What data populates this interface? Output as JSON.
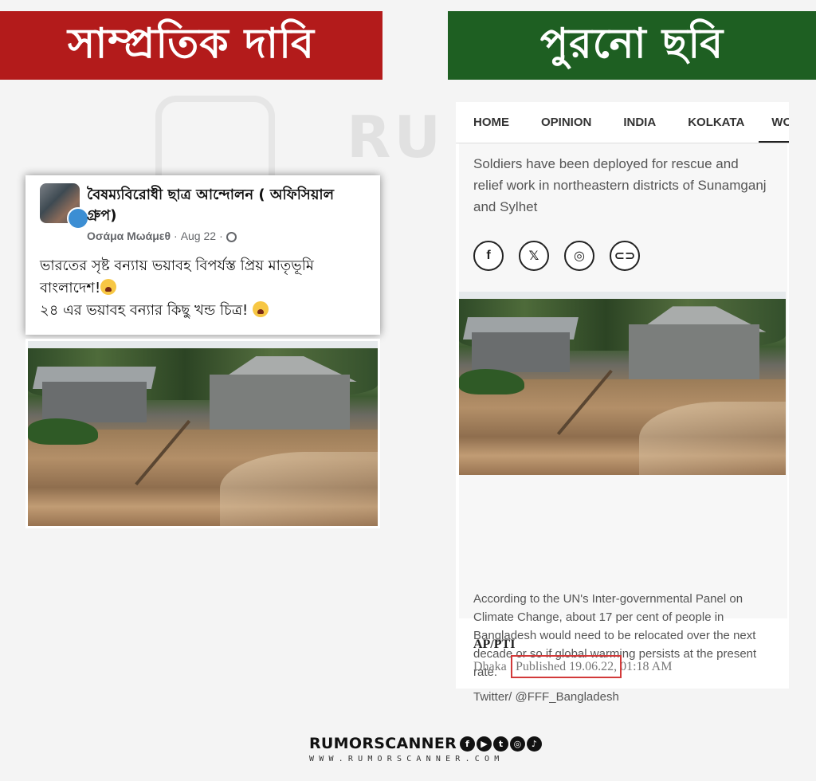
{
  "banners": {
    "left": "সাম্প্রতিক দাবি",
    "right": "পুরনো ছবি"
  },
  "facebook_post": {
    "group_name": "বৈষম্যবিরোধী ছাত্র আন্দোলন ( অফিসিয়াল গ্রুপ)",
    "author": "Οσάμα Μωάμεθ",
    "date": "Aug 22",
    "separator": "·",
    "line1": "ভারতের সৃষ্ট বন্যায় ভয়াবহ বিপর্যস্ত প্রিয় মাতৃভূমি বাংলাদেশ!",
    "line2": "২৪ এর ভয়াবহ বন্যার কিছু খন্ড চিত্র! "
  },
  "news_article": {
    "nav": [
      "HOME",
      "OPINION",
      "INDIA",
      "KOLKATA",
      "WO"
    ],
    "caption_top": "Soldiers have been deployed for rescue and relief work in northeastern districts of Sunamganj and Sylhet",
    "share_icons": [
      "facebook-icon",
      "x-icon",
      "whatsapp-icon",
      "link-icon"
    ],
    "share_glyphs": [
      "f",
      "𝕏",
      "◎",
      "⊂⊃"
    ],
    "caption_bottom": "According to the UN's Inter-governmental Panel on Climate Change, about 17 per cent of people in Bangladesh would need to be relocated over the next decade or so if global warming persists at the present rate.",
    "credit": "Twitter/ @FFF_Bangladesh",
    "agency": "AP/PTI",
    "place": "Dhaka |",
    "published": "Published 19.06.22,",
    "time": "01:18 AM"
  },
  "footer": {
    "brand": "RUMORSCANNER",
    "url": "WWW.RUMORSCANNER.COM"
  },
  "watermark": "RUMOR SCANNER",
  "colors": {
    "banner_red": "#b31b1b",
    "banner_green": "#1e5f22",
    "highlight": "#d23a3a"
  }
}
